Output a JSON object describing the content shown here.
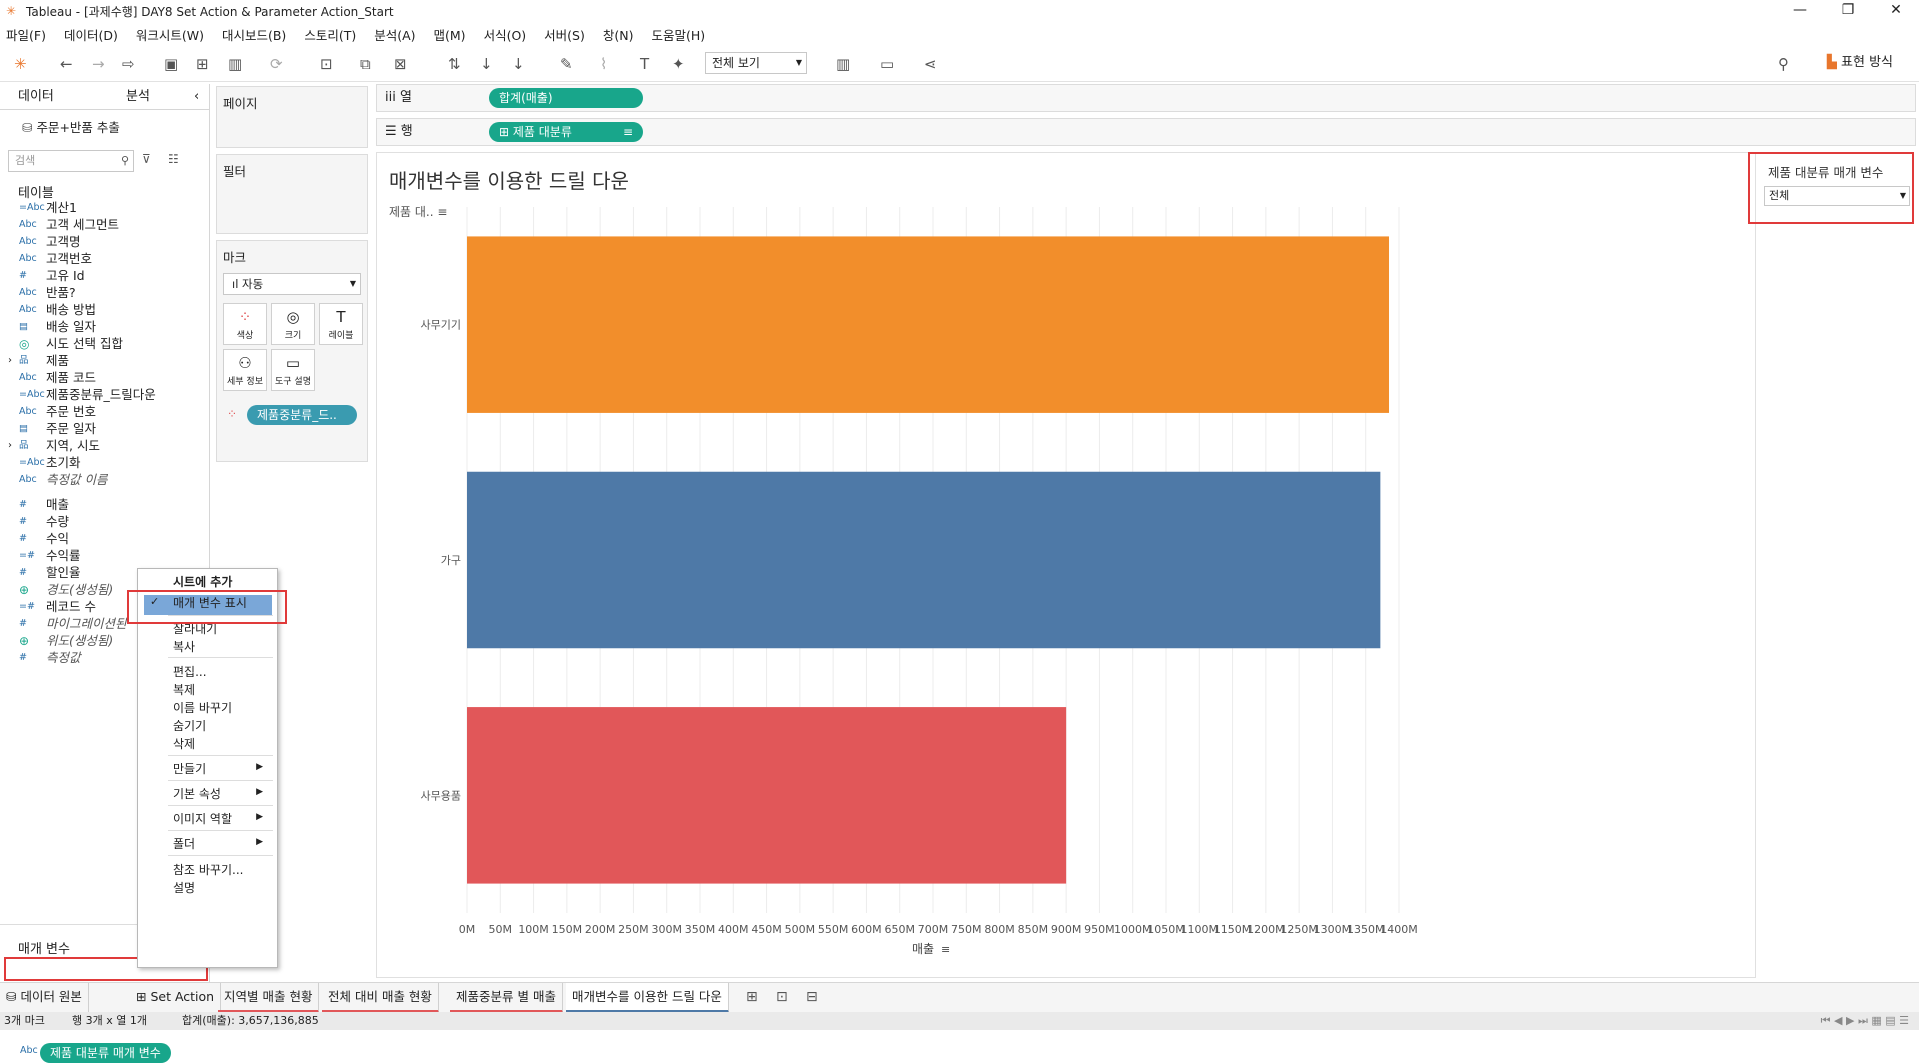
{
  "window": {
    "title": "Tableau - [과제수행] DAY8 Set Action & Parameter Action_Start"
  },
  "menu": [
    "파일(F)",
    "데이터(D)",
    "워크시트(W)",
    "대시보드(B)",
    "스토리(T)",
    "분석(A)",
    "맵(M)",
    "서식(O)",
    "서버(S)",
    "창(N)",
    "도움말(H)"
  ],
  "toolbar": {
    "view_select": "전체 보기",
    "show_me": "표현 방식"
  },
  "left": {
    "tab_data": "데이터",
    "tab_analysis": "분석",
    "datasource": "주문+반품 추출",
    "search_placeholder": "검색",
    "tables_header": "테이블",
    "fields": [
      {
        "icon": "=Abc",
        "name": "계산1"
      },
      {
        "icon": "Abc",
        "name": "고객 세그먼트"
      },
      {
        "icon": "Abc",
        "name": "고객명"
      },
      {
        "icon": "Abc",
        "name": "고객번호"
      },
      {
        "icon": "#",
        "name": "고유 Id"
      },
      {
        "icon": "Abc",
        "name": "반품?"
      },
      {
        "icon": "Abc",
        "name": "배송 방법"
      },
      {
        "icon": "▤",
        "name": "배송 일자"
      },
      {
        "icon": "◎",
        "name": "시도 선택 집합"
      },
      {
        "icon": "品",
        "name": "제품"
      },
      {
        "icon": "Abc",
        "name": "제품 코드"
      },
      {
        "icon": "=Abc",
        "name": "제품중분류_드릴다운"
      },
      {
        "icon": "Abc",
        "name": "주문 번호"
      },
      {
        "icon": "▤",
        "name": "주문 일자"
      },
      {
        "icon": "品",
        "name": "지역, 시도"
      },
      {
        "icon": "=Abc",
        "name": "초기화"
      },
      {
        "icon": "Abc",
        "name": "측정값 이름"
      },
      {
        "icon": "#",
        "name": "매출"
      },
      {
        "icon": "#",
        "name": "수량"
      },
      {
        "icon": "#",
        "name": "수익"
      },
      {
        "icon": "=#",
        "name": "수익률"
      },
      {
        "icon": "#",
        "name": "할인율"
      },
      {
        "icon": "⊕",
        "name": "경도(생성됨)"
      },
      {
        "icon": "=#",
        "name": "레코드 수"
      },
      {
        "icon": "#",
        "name": "마이그레이션된"
      },
      {
        "icon": "⊕",
        "name": "위도(생성됨)"
      },
      {
        "icon": "#",
        "name": "측정값"
      }
    ],
    "params_header": "매개 변수",
    "param_icon": "Abc",
    "param_pill": "제품 대분류 매개 변수"
  },
  "shelves": {
    "pages": "페이지",
    "filters": "필터",
    "marks": "마크",
    "marks_type": "자동",
    "mark_buttons": [
      "색상",
      "크기",
      "레이블",
      "세부 정보",
      "도구 설명"
    ],
    "color_pill": "제품중분류_드..",
    "columns_label": "열",
    "columns_pill": "합계(매출)",
    "rows_label": "행",
    "rows_pill": "제품 대분류"
  },
  "view": {
    "title": "매개변수를 이용한 드릴 다운",
    "row_header": "제품 대..",
    "x_title": "매출"
  },
  "param_card": {
    "title": "제품 대분류 매개 변수",
    "value": "전체"
  },
  "context_menu": {
    "items": [
      "시트에 추가",
      "매개 변수 표시",
      "잘라내기",
      "복사",
      "편집...",
      "복제",
      "이름 바꾸기",
      "숨기기",
      "삭제",
      "만들기",
      "기본 속성",
      "이미지 역할",
      "폴더",
      "참조 바꾸기...",
      "설명"
    ],
    "checked": "매개 변수 표시"
  },
  "sheet_tabs": [
    "데이터 원본",
    "Set Action",
    "지역별 매출 현황",
    "전체 대비 매출 현황",
    "제품중분류 별 매출",
    "매개변수를 이용한 드릴 다운"
  ],
  "status": {
    "marks": "3개 마크",
    "rows": "행 3개 x 열 1개",
    "sum": "합계(매출): 3,657,136,885"
  },
  "chart_data": {
    "type": "bar",
    "orientation": "horizontal",
    "categories": [
      "사무기기",
      "가구",
      "사무용품"
    ],
    "values": [
      1385000000,
      1372000000,
      900000000
    ],
    "colors": [
      "#f28e2b",
      "#4e79a7",
      "#e15759"
    ],
    "xlabel": "매출",
    "xlim": [
      0,
      1400000000
    ],
    "xticks": [
      "0M",
      "50M",
      "100M",
      "150M",
      "200M",
      "250M",
      "300M",
      "350M",
      "400M",
      "450M",
      "500M",
      "550M",
      "600M",
      "650M",
      "700M",
      "750M",
      "800M",
      "850M",
      "900M",
      "950M",
      "1000M",
      "1050M",
      "1100M",
      "1150M",
      "1200M",
      "1250M",
      "1300M",
      "1350M",
      "1400M"
    ],
    "grid": true
  }
}
